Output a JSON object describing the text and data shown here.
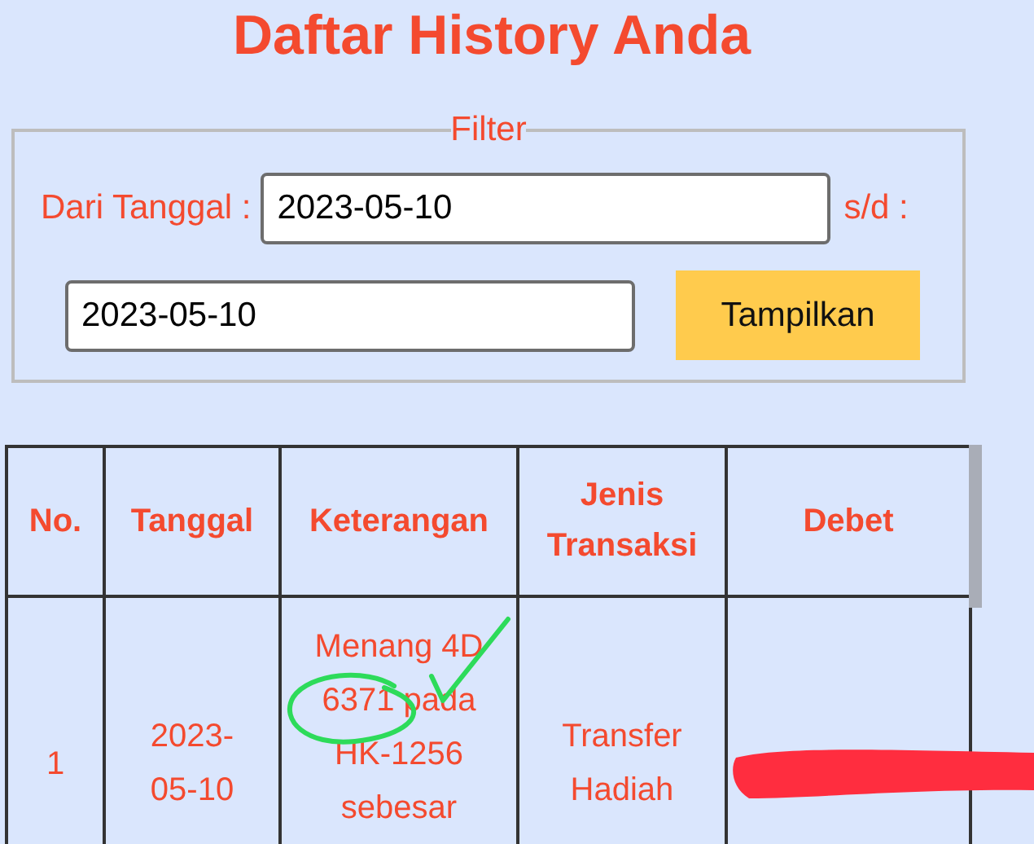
{
  "title": "Daftar History Anda",
  "filter": {
    "legend": "Filter",
    "from_label": "Dari Tanggal :",
    "from_value": "2023-05-10",
    "to_label": "s/d :",
    "to_value": "2023-05-10",
    "button": "Tampilkan"
  },
  "table": {
    "columns": [
      "No.",
      "Tanggal",
      "Keterangan",
      "Jenis Transaksi",
      "Debet"
    ],
    "rows": [
      {
        "no": "1",
        "tanggal": "2023-05-10",
        "keterangan": "Menang 4D 6371 pada HK-1256 sebesar",
        "jenis": "Transfer Hadiah"
      }
    ]
  }
}
